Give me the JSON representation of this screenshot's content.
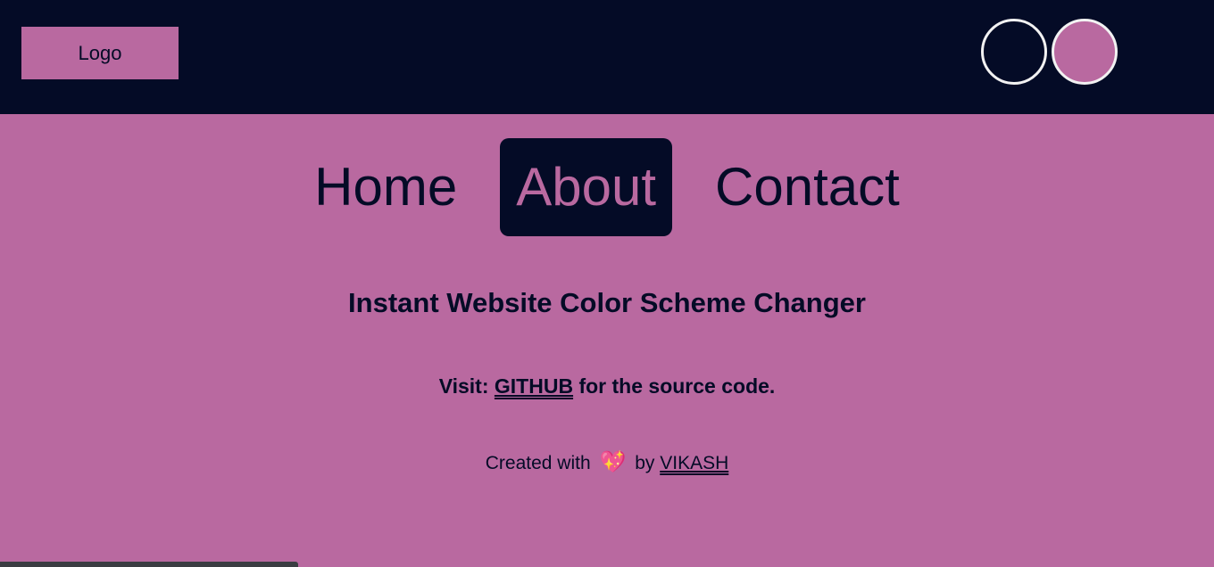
{
  "colors": {
    "dark": "#040b26",
    "pink": "#b969a0",
    "swatch_border": "#f2f2f2"
  },
  "header": {
    "logo_label": "Logo",
    "swatches": [
      {
        "name": "dark-theme",
        "color": "#040b26"
      },
      {
        "name": "pink-theme",
        "color": "#b969a0"
      }
    ]
  },
  "nav": {
    "items": [
      {
        "label": "Home",
        "active": false
      },
      {
        "label": "About",
        "active": true
      },
      {
        "label": "Contact",
        "active": false
      }
    ]
  },
  "main": {
    "headline": "Instant Website Color Scheme Changer",
    "visit_prefix": "Visit:",
    "visit_link": "GITHUB",
    "visit_suffix": "for the source code.",
    "credit_prefix": "Created with",
    "credit_icon": "sparkling-heart-icon",
    "credit_by": "by",
    "credit_link": "VIKASH"
  }
}
